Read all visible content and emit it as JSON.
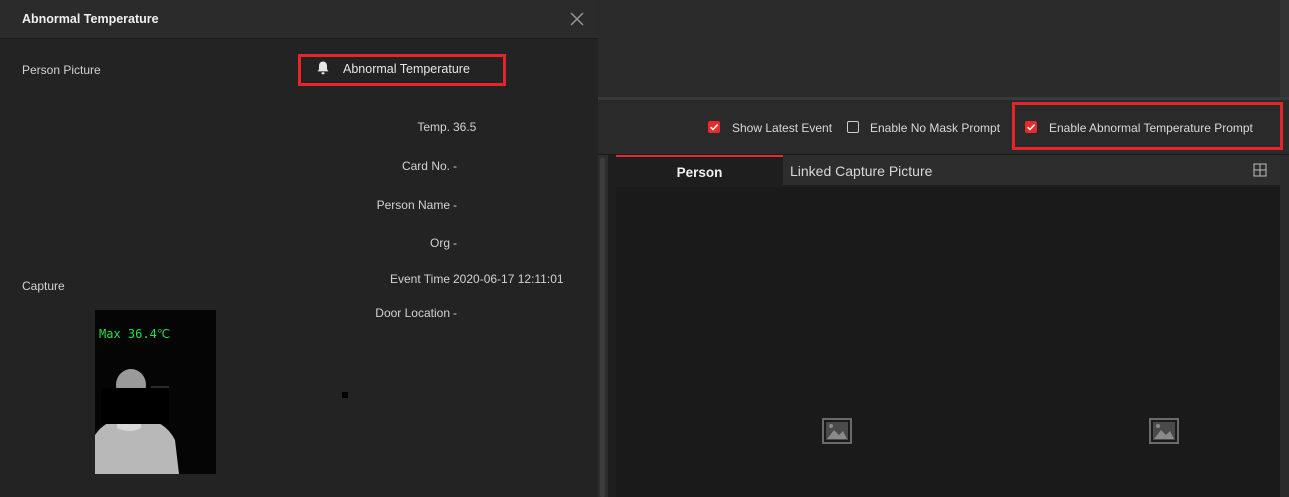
{
  "dialog": {
    "title": "Abnormal Temperature",
    "close_icon": "close-icon",
    "person_picture_label": "Person Picture",
    "capture_label": "Capture",
    "alarm": {
      "icon": "bell-icon",
      "text": "Abnormal Temperature"
    },
    "fields": [
      {
        "label": "Temp.",
        "value": "36.5"
      },
      {
        "label": "Card No.",
        "value": "-"
      },
      {
        "label": "Person Name",
        "value": "-"
      },
      {
        "label": "Org",
        "value": "-"
      },
      {
        "label": "Event Time",
        "value": "2020-06-17 12:11:01"
      },
      {
        "label": "Door Location",
        "value": "-"
      }
    ],
    "capture_overlay": "Max 36.4℃"
  },
  "toolbar": {
    "options": [
      {
        "label": "Show Latest Event",
        "checked": true
      },
      {
        "label": "Enable No Mask Prompt",
        "checked": false
      },
      {
        "label": "Enable Abnormal Temperature Prompt",
        "checked": true
      }
    ]
  },
  "tabs": [
    {
      "label": "Person",
      "active": true
    },
    {
      "label": "Linked Capture Picture",
      "active": false
    }
  ],
  "icons": {
    "expand": "expand-icon",
    "placeholder": "image-placeholder-icon"
  },
  "colors": {
    "accent": "#e52b2b",
    "highlight_box": "#e8232a",
    "overlay_text": "#22e04a"
  }
}
